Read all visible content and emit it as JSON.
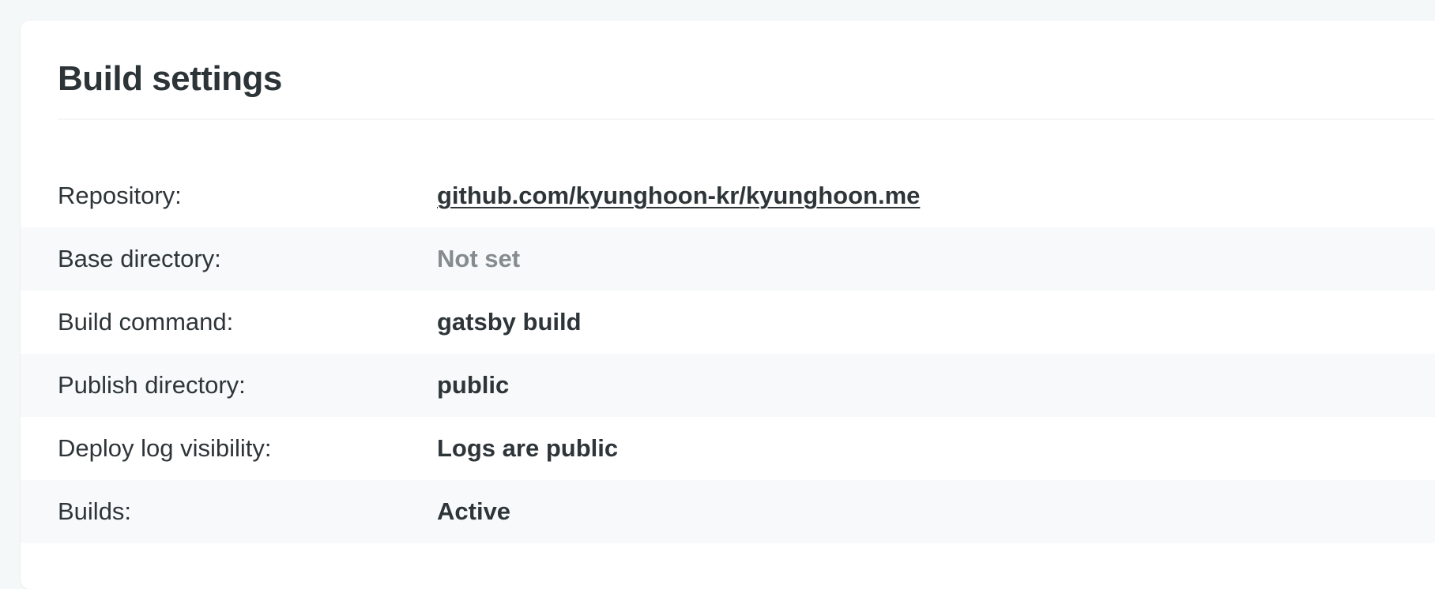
{
  "section": {
    "title": "Build settings"
  },
  "settings": [
    {
      "label": "Repository:",
      "value": "github.com/kyunghoon-kr/kyunghoon.me"
    },
    {
      "label": "Base directory:",
      "value": "Not set"
    },
    {
      "label": "Build command:",
      "value": "gatsby build"
    },
    {
      "label": "Publish directory:",
      "value": "public"
    },
    {
      "label": "Deploy log visibility:",
      "value": "Logs are public"
    },
    {
      "label": "Builds:",
      "value": "Active"
    }
  ],
  "colors": {
    "page_background": "#f5f8f9",
    "card_background": "#ffffff",
    "row_alt_background": "#f7f9fa",
    "text": "#2e3538",
    "muted_text": "#858b8e"
  }
}
